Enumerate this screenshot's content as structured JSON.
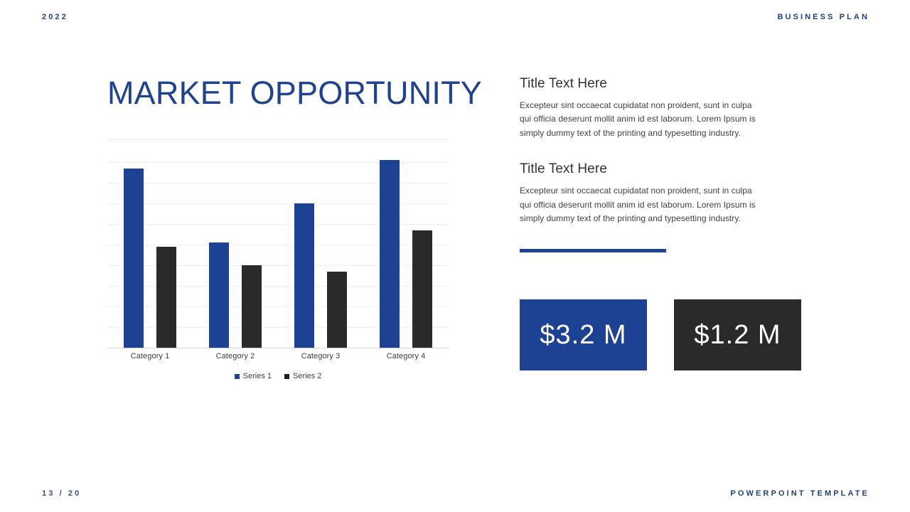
{
  "header": {
    "year": "2022",
    "label": "BUSINESS PLAN"
  },
  "footer": {
    "page": "13 / 20",
    "label": "POWERPOINT TEMPLATE"
  },
  "slide": {
    "title": "MARKET OPPORTUNITY"
  },
  "colors": {
    "series1": "#1d4193",
    "series2": "#2a2a2a",
    "title": "#20438f",
    "header_text": "#22417e"
  },
  "content": {
    "blocks": [
      {
        "title": "Title Text Here",
        "body": "Excepteur sint occaecat cupidatat non proident, sunt in culpa qui officia deserunt mollit anim id est laborum. Lorem Ipsum is simply dummy text of the printing and typesetting industry."
      },
      {
        "title": "Title Text Here",
        "body": "Excepteur sint occaecat cupidatat non proident, sunt in culpa qui officia deserunt mollit anim id est laborum. Lorem Ipsum is simply dummy text of the printing and typesetting industry."
      }
    ]
  },
  "stats": [
    {
      "value": "$3.2 M",
      "style": "blue"
    },
    {
      "value": "$1.2 M",
      "style": "dark"
    }
  ],
  "chart_data": {
    "type": "bar",
    "title": "",
    "xlabel": "",
    "ylabel": "",
    "ylim": [
      0,
      10
    ],
    "grid": true,
    "gridline_count": 11,
    "legend_position": "bottom",
    "categories": [
      "Category 1",
      "Category 2",
      "Category 3",
      "Category 4"
    ],
    "series": [
      {
        "name": "Series 1",
        "color": "#1d4193",
        "values": [
          8.7,
          5.1,
          7.0,
          9.1
        ]
      },
      {
        "name": "Series 2",
        "color": "#2a2a2a",
        "values": [
          4.9,
          4.0,
          3.7,
          5.7
        ]
      }
    ]
  }
}
